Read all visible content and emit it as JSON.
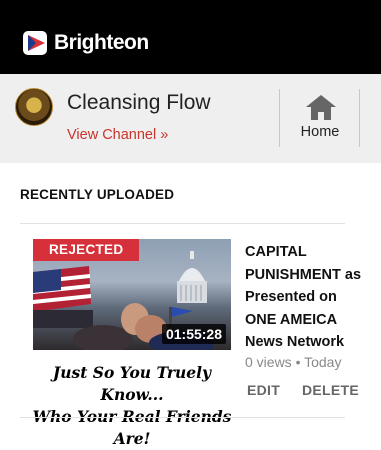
{
  "header": {
    "logo_text": "Brighteon",
    "logo_icon": "brighteon-logo-icon"
  },
  "channel": {
    "name": "Cleansing Flow",
    "view_channel_label": "View Channel »",
    "home_label": "Home",
    "home_icon": "home-icon"
  },
  "section": {
    "title": "RECENTLY UPLOADED"
  },
  "video": {
    "status_badge": "REJECTED",
    "duration": "01:55:28",
    "caption": "Just So You Truely Know...\nWho Your Real Friends Are!",
    "title": "CAPITAL PUNISHMENT as Presented on ONE AMEICA News Network",
    "meta": "0 views • Today",
    "edit_label": "EDIT",
    "delete_label": "DELETE"
  },
  "colors": {
    "accent_red": "#d6303a",
    "link_red": "#c8342b",
    "topbar": "#000000",
    "channelbar": "#efefef"
  }
}
